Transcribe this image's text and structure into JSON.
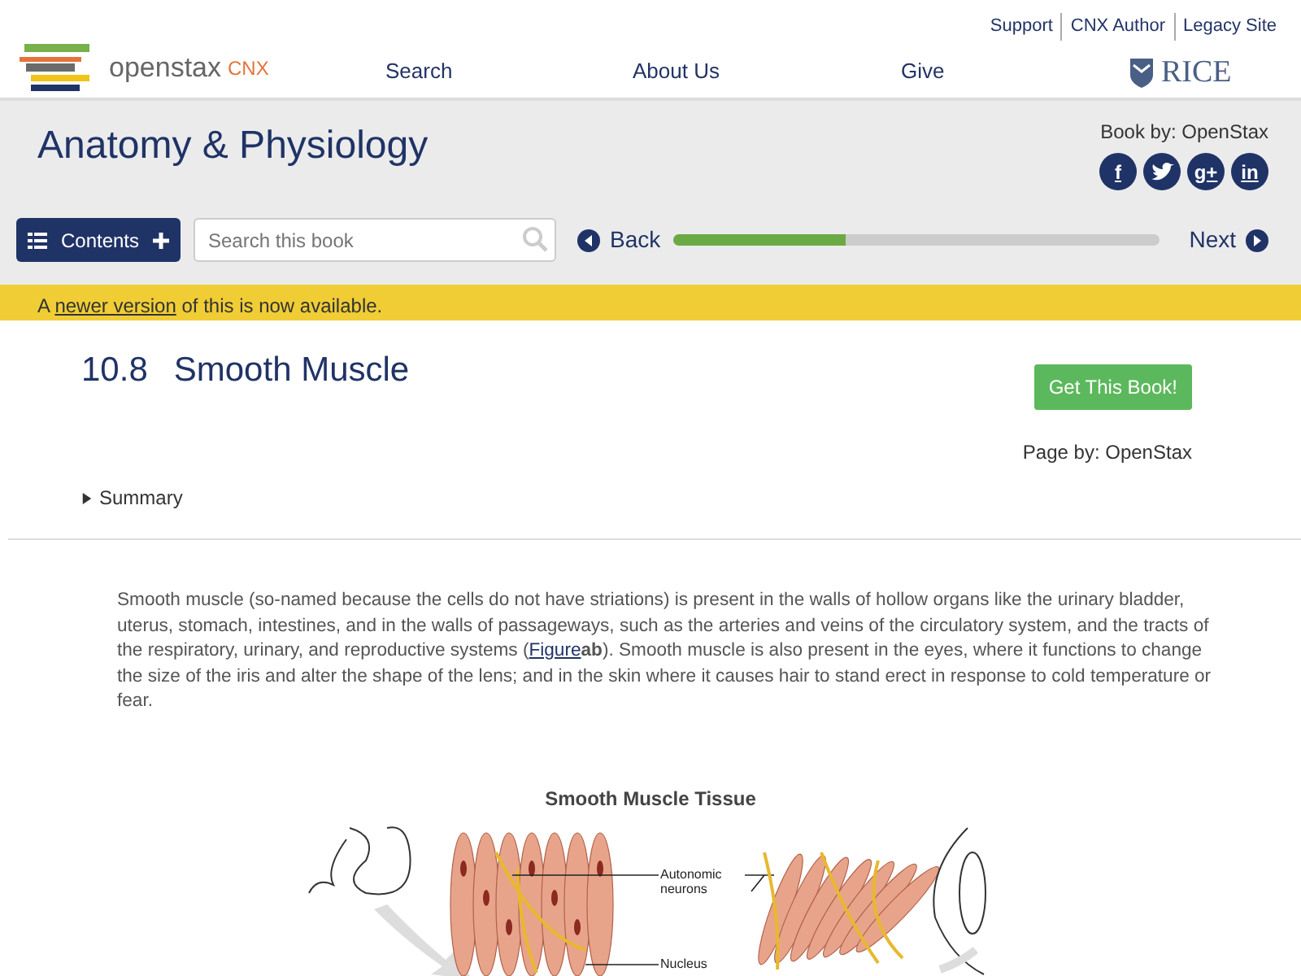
{
  "header": {
    "top_links": [
      "Support",
      "CNX Author",
      "Legacy Site"
    ],
    "logo_text": "openstax",
    "logo_suffix": "CNX",
    "nav": [
      "Search",
      "About Us",
      "Give"
    ],
    "partner_logo": "RICE"
  },
  "book": {
    "title": "Anatomy & Physiology",
    "byline": "Book by: OpenStax",
    "social": [
      {
        "kind": "letter",
        "label": "f"
      },
      {
        "kind": "bird"
      },
      {
        "kind": "letter",
        "label": "g+"
      },
      {
        "kind": "letter",
        "label": "in"
      }
    ]
  },
  "toolbar": {
    "contents": "Contents",
    "search": {
      "placeholder": "Search this book"
    },
    "back": "Back",
    "next": "Next",
    "progress": {
      "level": 0.355
    }
  },
  "notice": {
    "before": "A",
    "link": "newer version",
    "after": "of this is now available."
  },
  "page": {
    "number": "10.8",
    "title": "Smooth Muscle",
    "get_book": "Get This Book!",
    "page_by": "Page by: OpenStax",
    "summary": {
      "label": "Summary",
      "expanded": false
    }
  },
  "paragraph": {
    "before": "Smooth muscle (so-named because the cells do not have striations) is present in the walls of hollow organs like the urinary bladder, uterus, stomach, intestines, and in the walls of passageways, such as the arteries and veins of the circulatory system, and the tracts of the respiratory, urinary, and reproductive systems (",
    "link": "Figure",
    "after": "**ab**). Smooth muscle is also present in the eyes, where it functions to change the size of the iris and alter the shape of the lens; and in the skin where it causes hair to stand erect in response to cold temperature or fear."
  },
  "figure": {
    "title": "Smooth Muscle Tissue",
    "labels": [
      "Autonomic neurons",
      "Nucleus"
    ]
  }
}
